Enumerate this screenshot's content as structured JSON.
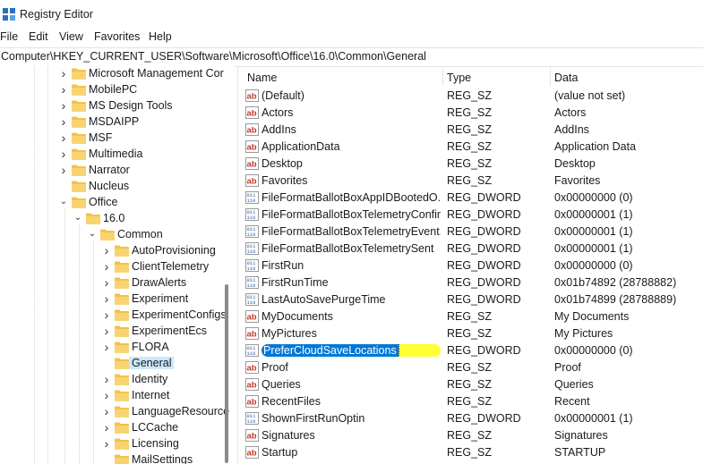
{
  "window": {
    "title": "Registry Editor"
  },
  "menu": [
    "File",
    "Edit",
    "View",
    "Favorites",
    "Help"
  ],
  "address": "Computer\\HKEY_CURRENT_USER\\Software\\Microsoft\\Office\\16.0\\Common\\General",
  "tree": [
    {
      "label": "Microsoft Management Cor",
      "depth": 0,
      "expanded": false
    },
    {
      "label": "MobilePC",
      "depth": 0,
      "expanded": false
    },
    {
      "label": "MS Design Tools",
      "depth": 0,
      "expanded": false
    },
    {
      "label": "MSDAIPP",
      "depth": 0,
      "expanded": false
    },
    {
      "label": "MSF",
      "depth": 0,
      "expanded": false
    },
    {
      "label": "Multimedia",
      "depth": 0,
      "expanded": false
    },
    {
      "label": "Narrator",
      "depth": 0,
      "expanded": false
    },
    {
      "label": "Nucleus",
      "depth": 0,
      "expanded": null
    },
    {
      "label": "Office",
      "depth": 0,
      "expanded": true
    },
    {
      "label": "16.0",
      "depth": 1,
      "expanded": true
    },
    {
      "label": "Common",
      "depth": 2,
      "expanded": true
    },
    {
      "label": "AutoProvisioning",
      "depth": 3,
      "expanded": false
    },
    {
      "label": "ClientTelemetry",
      "depth": 3,
      "expanded": false
    },
    {
      "label": "DrawAlerts",
      "depth": 3,
      "expanded": false
    },
    {
      "label": "Experiment",
      "depth": 3,
      "expanded": false
    },
    {
      "label": "ExperimentConfigs",
      "depth": 3,
      "expanded": false
    },
    {
      "label": "ExperimentEcs",
      "depth": 3,
      "expanded": false
    },
    {
      "label": "FLORA",
      "depth": 3,
      "expanded": false
    },
    {
      "label": "General",
      "depth": 3,
      "expanded": null,
      "selected": true
    },
    {
      "label": "Identity",
      "depth": 3,
      "expanded": false
    },
    {
      "label": "Internet",
      "depth": 3,
      "expanded": false
    },
    {
      "label": "LanguageResource",
      "depth": 3,
      "expanded": false
    },
    {
      "label": "LCCache",
      "depth": 3,
      "expanded": false
    },
    {
      "label": "Licensing",
      "depth": 3,
      "expanded": false
    },
    {
      "label": "MailSettings",
      "depth": 3,
      "expanded": null
    }
  ],
  "columns": {
    "name": "Name",
    "type": "Type",
    "data": "Data"
  },
  "values": [
    {
      "icon": "string-value-icon",
      "name": "(Default)",
      "type": "REG_SZ",
      "data": "(value not set)"
    },
    {
      "icon": "string-value-icon",
      "name": "Actors",
      "type": "REG_SZ",
      "data": "Actors"
    },
    {
      "icon": "string-value-icon",
      "name": "AddIns",
      "type": "REG_SZ",
      "data": "AddIns"
    },
    {
      "icon": "string-value-icon",
      "name": "ApplicationData",
      "type": "REG_SZ",
      "data": "Application Data"
    },
    {
      "icon": "string-value-icon",
      "name": "Desktop",
      "type": "REG_SZ",
      "data": "Desktop"
    },
    {
      "icon": "string-value-icon",
      "name": "Favorites",
      "type": "REG_SZ",
      "data": "Favorites"
    },
    {
      "icon": "binary-value-icon",
      "name": "FileFormatBallotBoxAppIDBootedO...",
      "type": "REG_DWORD",
      "data": "0x00000000 (0)"
    },
    {
      "icon": "binary-value-icon",
      "name": "FileFormatBallotBoxTelemetryConfir...",
      "type": "REG_DWORD",
      "data": "0x00000001 (1)"
    },
    {
      "icon": "binary-value-icon",
      "name": "FileFormatBallotBoxTelemetryEvent...",
      "type": "REG_DWORD",
      "data": "0x00000001 (1)"
    },
    {
      "icon": "binary-value-icon",
      "name": "FileFormatBallotBoxTelemetrySent",
      "type": "REG_DWORD",
      "data": "0x00000001 (1)"
    },
    {
      "icon": "binary-value-icon",
      "name": "FirstRun",
      "type": "REG_DWORD",
      "data": "0x00000000 (0)"
    },
    {
      "icon": "binary-value-icon",
      "name": "FirstRunTime",
      "type": "REG_DWORD",
      "data": "0x01b74892 (28788882)"
    },
    {
      "icon": "binary-value-icon",
      "name": "LastAutoSavePurgeTime",
      "type": "REG_DWORD",
      "data": "0x01b74899 (28788889)"
    },
    {
      "icon": "string-value-icon",
      "name": "MyDocuments",
      "type": "REG_SZ",
      "data": "My Documents"
    },
    {
      "icon": "string-value-icon",
      "name": "MyPictures",
      "type": "REG_SZ",
      "data": "My Pictures"
    },
    {
      "icon": "binary-value-icon",
      "name": "PreferCloudSaveLocations",
      "type": "REG_DWORD",
      "data": "0x00000000 (0)",
      "selected": true
    },
    {
      "icon": "string-value-icon",
      "name": "Proof",
      "type": "REG_SZ",
      "data": "Proof"
    },
    {
      "icon": "string-value-icon",
      "name": "Queries",
      "type": "REG_SZ",
      "data": "Queries"
    },
    {
      "icon": "string-value-icon",
      "name": "RecentFiles",
      "type": "REG_SZ",
      "data": "Recent"
    },
    {
      "icon": "binary-value-icon",
      "name": "ShownFirstRunOptin",
      "type": "REG_DWORD",
      "data": "0x00000001 (1)"
    },
    {
      "icon": "string-value-icon",
      "name": "Signatures",
      "type": "REG_SZ",
      "data": "Signatures"
    },
    {
      "icon": "string-value-icon",
      "name": "Startup",
      "type": "REG_SZ",
      "data": "STARTUP"
    }
  ],
  "colors": {
    "folder": "#f3c14a",
    "selection": "#0078d7",
    "highlight": "#ffff33",
    "tree_selected": "#cce8ff"
  }
}
